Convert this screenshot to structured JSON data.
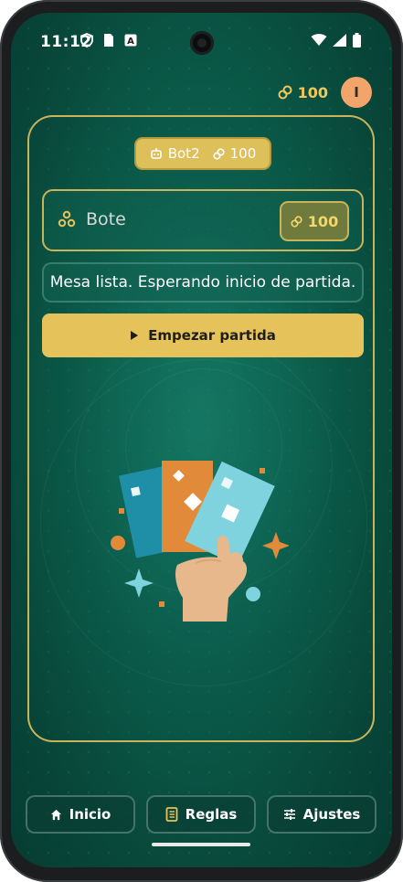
{
  "status_bar": {
    "time": "11:12",
    "left_icons": [
      "shield-icon",
      "sim-card-icon",
      "keyboard-a-icon"
    ],
    "right_icons": [
      "wifi-icon",
      "signal-icon",
      "battery-icon"
    ]
  },
  "header": {
    "coins": "100",
    "avatar_initial": "I"
  },
  "table": {
    "bot_name": "Bot2",
    "bot_coins": "100",
    "pot_label": "Bote",
    "pot_amount": "100",
    "status_message": "Mesa lista. Esperando inicio de partida.",
    "start_button": "Empezar partida"
  },
  "nav": {
    "items": [
      {
        "label": "Inicio",
        "icon": "home-icon"
      },
      {
        "label": "Reglas",
        "icon": "book-icon"
      },
      {
        "label": "Ajustes",
        "icon": "sliders-icon"
      }
    ]
  },
  "colors": {
    "accent_gold": "#e6c25a",
    "background_green": "#0b5a49",
    "avatar": "#f2a56b"
  }
}
